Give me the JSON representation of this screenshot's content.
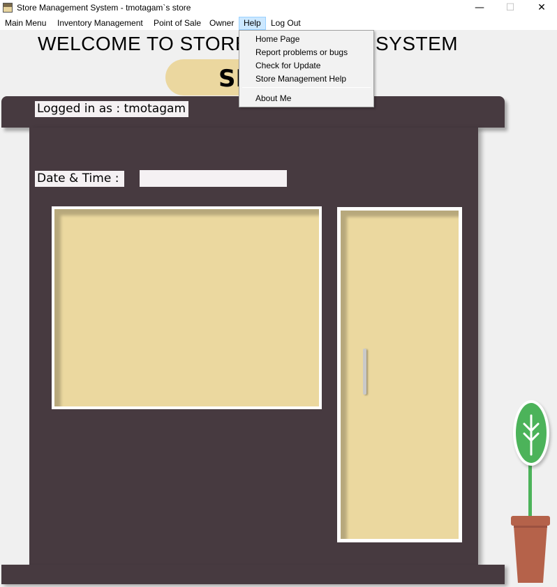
{
  "window": {
    "title": "Store Management System - tmotagam`s store",
    "minimize": "—",
    "maximize": "☐",
    "close": "✕"
  },
  "menubar": {
    "items": [
      {
        "label": "Main Menu"
      },
      {
        "label": "Inventory Management"
      },
      {
        "label": "Point of Sale"
      },
      {
        "label": "Owner"
      },
      {
        "label": "Help"
      },
      {
        "label": "Log Out"
      }
    ]
  },
  "help_menu": {
    "items": [
      {
        "label": "Home Page"
      },
      {
        "label": "Report problems or bugs"
      },
      {
        "label": "Check for Update"
      },
      {
        "label": "Store Management Help"
      },
      {
        "label": "About Me"
      }
    ]
  },
  "main": {
    "welcome_visible_left": "WELCOME TO STORE",
    "welcome_visible_right": "SYSTEM",
    "sign_visible": "SI",
    "logged_in_label": "Logged in as :  tmotagam",
    "date_time_label": "Date & Time :",
    "date_time_value": ""
  },
  "colors": {
    "building": "#473a40",
    "pane": "#ebd89f",
    "plant": "#4cb35a",
    "pot": "#b5624a",
    "menu_highlight": "#cce8ff"
  }
}
